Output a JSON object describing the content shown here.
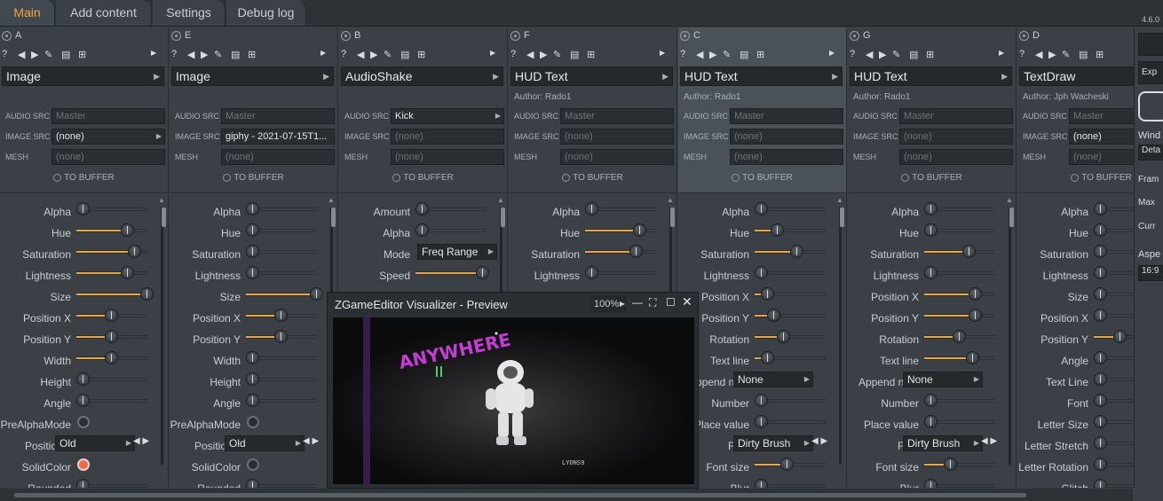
{
  "tabs": [
    {
      "label": "Main"
    },
    {
      "label": "Add content"
    },
    {
      "label": "Settings"
    },
    {
      "label": "Debug log"
    }
  ],
  "version": "4.6.0",
  "common": {
    "audio_src_label": "AUDIO SRC",
    "image_src_label": "IMAGE SRC",
    "mesh_label": "MESH",
    "to_buffer_label": "TO BUFFER",
    "help_glyph": "?"
  },
  "columns": [
    {
      "letter": "A",
      "title": "Image",
      "author": "",
      "audio_src": "Master",
      "image_src": "(none)",
      "mesh": "(none)"
    },
    {
      "letter": "E",
      "title": "Image",
      "author": "",
      "audio_src": "Master",
      "image_src": "giphy - 2021-07-15T1...",
      "mesh": "(none)"
    },
    {
      "letter": "B",
      "title": "AudioShake",
      "author": "",
      "audio_src": "Kick",
      "image_src": "(none)",
      "mesh": "(none)"
    },
    {
      "letter": "F",
      "title": "HUD Text",
      "author": "Author: Rado1",
      "audio_src": "Master",
      "image_src": "(none)",
      "mesh": "(none)"
    },
    {
      "letter": "C",
      "title": "HUD Text",
      "author": "Author: Rado1",
      "audio_src": "Master",
      "image_src": "(none)",
      "mesh": "(none)"
    },
    {
      "letter": "G",
      "title": "HUD Text",
      "author": "Author: Rado1",
      "audio_src": "Master",
      "image_src": "(none)",
      "mesh": "(none)"
    },
    {
      "letter": "D",
      "title": "TextDraw",
      "author": "Author: Jph Wacheski",
      "audio_src": "Master",
      "image_src": "(none)",
      "mesh": "(none)"
    }
  ],
  "params": {
    "A": [
      {
        "label": "Alpha",
        "kind": "slider",
        "value": 0.0
      },
      {
        "label": "Hue",
        "kind": "slider",
        "value": 0.7
      },
      {
        "label": "Saturation",
        "kind": "slider",
        "value": 0.8
      },
      {
        "label": "Lightness",
        "kind": "slider",
        "value": 0.7
      },
      {
        "label": "Size",
        "kind": "slider",
        "value": 1.0
      },
      {
        "label": "Position X",
        "kind": "slider",
        "value": 0.45
      },
      {
        "label": "Position Y",
        "kind": "slider",
        "value": 0.45
      },
      {
        "label": "Width",
        "kind": "slider",
        "value": 0.45
      },
      {
        "label": "Height",
        "kind": "slider",
        "value": 0.0
      },
      {
        "label": "Angle",
        "kind": "slider",
        "value": 0.0
      },
      {
        "label": "PreAlphaMode",
        "kind": "toggle",
        "on": false
      },
      {
        "label": "Positionin",
        "kind": "select",
        "value": "Old"
      },
      {
        "label": "SolidColor",
        "kind": "toggle",
        "on": true
      },
      {
        "label": "Rounded",
        "kind": "slider",
        "value": 0.0
      }
    ],
    "E": [
      {
        "label": "Alpha",
        "kind": "slider",
        "value": 0.0
      },
      {
        "label": "Hue",
        "kind": "slider",
        "value": 0.0
      },
      {
        "label": "Saturation",
        "kind": "slider",
        "value": 0.0
      },
      {
        "label": "Lightness",
        "kind": "slider",
        "value": 0.0
      },
      {
        "label": "Size",
        "kind": "slider",
        "value": 1.0
      },
      {
        "label": "Position X",
        "kind": "slider",
        "value": 0.45
      },
      {
        "label": "Position Y",
        "kind": "slider",
        "value": 0.45
      },
      {
        "label": "Width",
        "kind": "slider",
        "value": 0.0
      },
      {
        "label": "Height",
        "kind": "slider",
        "value": 0.0
      },
      {
        "label": "Angle",
        "kind": "slider",
        "value": 0.0
      },
      {
        "label": "PreAlphaMode",
        "kind": "toggle",
        "on": false
      },
      {
        "label": "Positionin",
        "kind": "select",
        "value": "Old"
      },
      {
        "label": "SolidColor",
        "kind": "toggle",
        "on": false
      },
      {
        "label": "Rounded",
        "kind": "slider",
        "value": 0.0
      }
    ],
    "B": [
      {
        "label": "Amount",
        "kind": "slider",
        "value": 0.0
      },
      {
        "label": "Alpha",
        "kind": "slider",
        "value": 0.0
      },
      {
        "label": "Mode",
        "kind": "select",
        "value": "Freq Range"
      },
      {
        "label": "Speed",
        "kind": "slider",
        "value": 0.95
      }
    ],
    "F": [
      {
        "label": "Alpha",
        "kind": "slider",
        "value": 0.0
      },
      {
        "label": "Hue",
        "kind": "slider",
        "value": 0.75
      },
      {
        "label": "Saturation",
        "kind": "slider",
        "value": 0.7
      },
      {
        "label": "Lightness",
        "kind": "slider",
        "value": 0.0
      }
    ],
    "C": [
      {
        "label": "Alpha",
        "kind": "slider",
        "value": 0.0
      },
      {
        "label": "Hue",
        "kind": "slider",
        "value": 0.25
      },
      {
        "label": "Saturation",
        "kind": "slider",
        "value": 0.55
      },
      {
        "label": "Lightness",
        "kind": "slider",
        "value": 0.0
      },
      {
        "label": "Position X",
        "kind": "slider",
        "value": 0.1
      },
      {
        "label": "Position Y",
        "kind": "slider",
        "value": 0.2
      },
      {
        "label": "Rotation",
        "kind": "slider",
        "value": 0.35
      },
      {
        "label": "Text line",
        "kind": "slider",
        "value": 0.1
      },
      {
        "label": "Append num",
        "kind": "select",
        "value": "None"
      },
      {
        "label": "Number",
        "kind": "slider",
        "value": 0.0
      },
      {
        "label": "Place value",
        "kind": "slider",
        "value": 0.0
      },
      {
        "label": "Font",
        "kind": "select",
        "value": "Dirty Brush"
      },
      {
        "label": "Font size",
        "kind": "slider",
        "value": 0.4
      },
      {
        "label": "Blur",
        "kind": "slider",
        "value": 0.0
      }
    ],
    "G": [
      {
        "label": "Alpha",
        "kind": "slider",
        "value": 0.0
      },
      {
        "label": "Hue",
        "kind": "slider",
        "value": 0.0
      },
      {
        "label": "Saturation",
        "kind": "slider",
        "value": 0.6
      },
      {
        "label": "Lightness",
        "kind": "slider",
        "value": 0.0
      },
      {
        "label": "Position X",
        "kind": "slider",
        "value": 0.7
      },
      {
        "label": "Position Y",
        "kind": "slider",
        "value": 0.7
      },
      {
        "label": "Rotation",
        "kind": "slider",
        "value": 0.45
      },
      {
        "label": "Text line",
        "kind": "slider",
        "value": 0.65
      },
      {
        "label": "Append num",
        "kind": "select",
        "value": "None"
      },
      {
        "label": "Number",
        "kind": "slider",
        "value": 0.0
      },
      {
        "label": "Place value",
        "kind": "slider",
        "value": 0.0
      },
      {
        "label": "Font",
        "kind": "select",
        "value": "Dirty Brush"
      },
      {
        "label": "Font size",
        "kind": "slider",
        "value": 0.3
      },
      {
        "label": "Blur",
        "kind": "slider",
        "value": 0.0
      }
    ],
    "D": [
      {
        "label": "Alpha",
        "kind": "slider",
        "value": 0.0
      },
      {
        "label": "Hue",
        "kind": "slider",
        "value": 0.0
      },
      {
        "label": "Saturation",
        "kind": "slider",
        "value": 0.0
      },
      {
        "label": "Lightness",
        "kind": "slider",
        "value": 0.0
      },
      {
        "label": "Size",
        "kind": "slider",
        "value": 0.0
      },
      {
        "label": "Position X",
        "kind": "slider",
        "value": 0.0
      },
      {
        "label": "Position Y",
        "kind": "slider",
        "value": 0.3
      },
      {
        "label": "Angle",
        "kind": "slider",
        "value": 0.0
      },
      {
        "label": "Text Line",
        "kind": "slider",
        "value": 0.0
      },
      {
        "label": "Font",
        "kind": "slider",
        "value": 0.0
      },
      {
        "label": "Letter Size",
        "kind": "slider",
        "value": 0.0
      },
      {
        "label": "Letter Stretch",
        "kind": "slider",
        "value": 0.0
      },
      {
        "label": "Letter Rotation",
        "kind": "slider",
        "value": 0.0
      },
      {
        "label": "Glitch",
        "kind": "slider",
        "value": 0.0
      }
    ]
  },
  "preview": {
    "title": "ZGameEditor Visualizer - Preview",
    "zoom": "100%",
    "scene_text": "ANYWHERE",
    "scene_small_text": "LYONS9"
  },
  "right_panel": {
    "export_label": "Exp",
    "window_label": "Wind",
    "detach_label": "Deta",
    "frame_label": "Fram",
    "max_label": "Max",
    "current_label": "Curr",
    "aspect_label": "Aspe",
    "aspect_value": "16:9"
  },
  "colors": {
    "accent": "#f0a43c",
    "solid_toggle": "#f06a4a",
    "scene_text": "#c43ed6"
  }
}
